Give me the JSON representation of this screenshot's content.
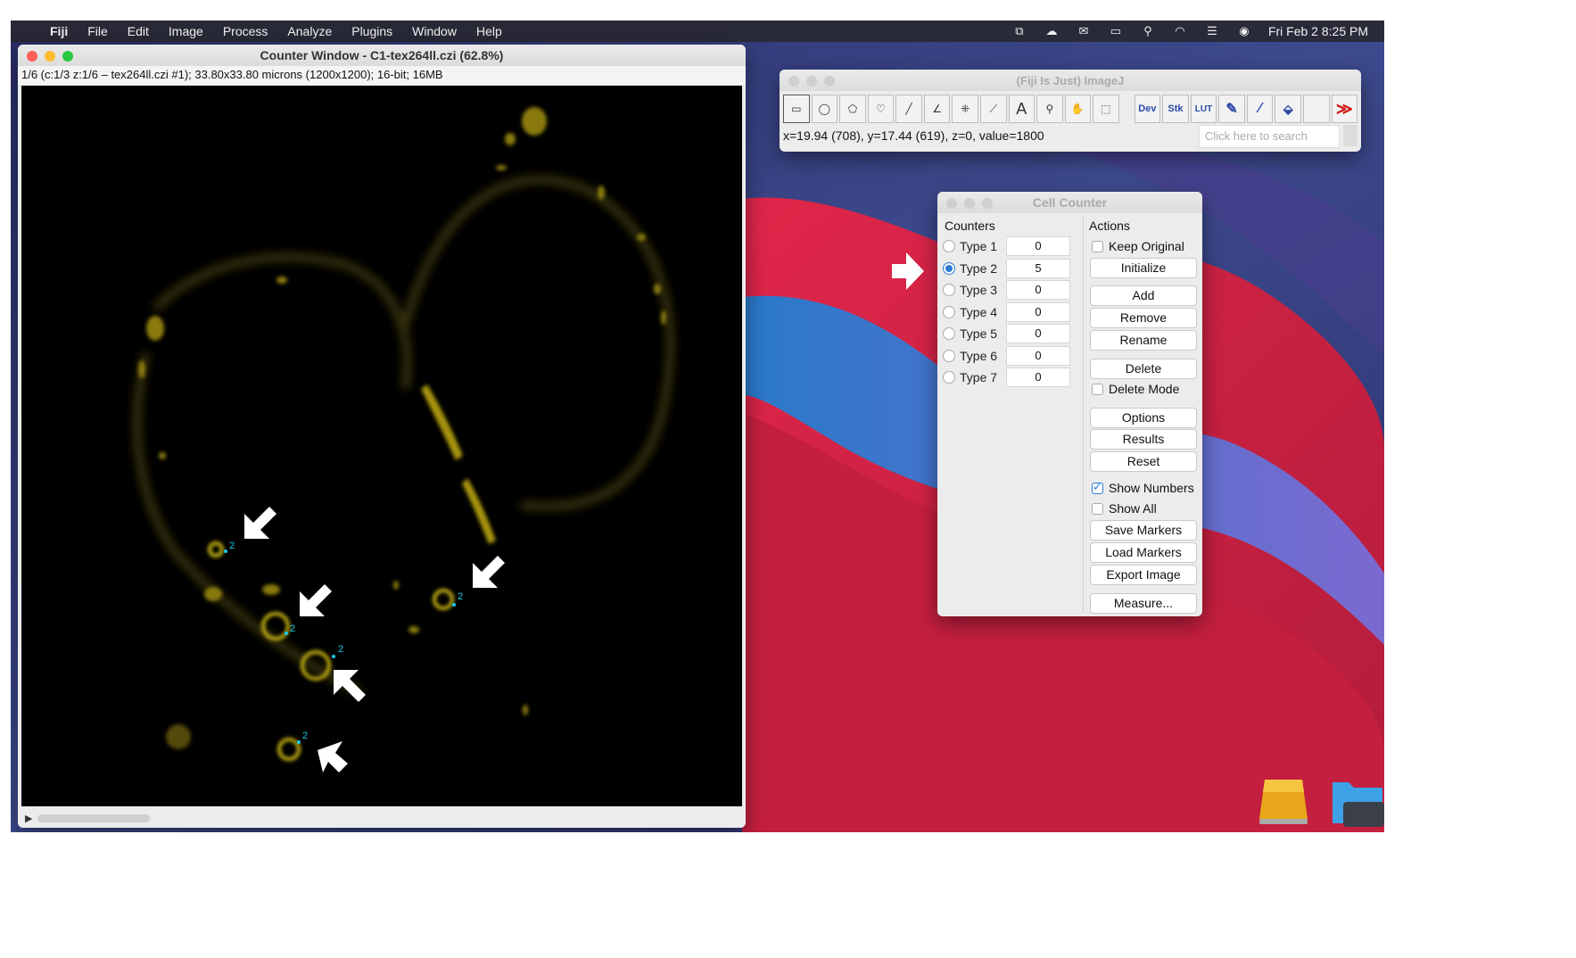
{
  "menubar": {
    "apple": "",
    "app": "Fiji",
    "items": [
      "File",
      "Edit",
      "Image",
      "Process",
      "Analyze",
      "Plugins",
      "Window",
      "Help"
    ],
    "clock": "Fri Feb 2  8:25 PM",
    "status_icons": [
      "dropbox-icon",
      "creative-cloud-icon",
      "outlook-icon",
      "battery-icon",
      "search-icon",
      "wifi-icon",
      "control-center-icon",
      "siri-icon"
    ]
  },
  "counter_window": {
    "title": "Counter Window - C1-tex264ll.czi (62.8%)",
    "info": "1/6 (c:1/3 z:1/6 – tex264ll.czi #1); 33.80x33.80 microns (1200x1200); 16-bit; 16MB",
    "marker_label": "2",
    "marker_color": "#1ac8e8"
  },
  "imagej": {
    "title": "(Fiji Is Just) ImageJ",
    "tools": [
      {
        "name": "rectangle-tool-icon",
        "glyph": "▭"
      },
      {
        "name": "oval-tool-icon",
        "glyph": "◯"
      },
      {
        "name": "polygon-tool-icon",
        "glyph": "⬠"
      },
      {
        "name": "freehand-tool-icon",
        "glyph": "♡"
      },
      {
        "name": "line-tool-icon",
        "glyph": "╱"
      },
      {
        "name": "angle-tool-icon",
        "glyph": "∠"
      },
      {
        "name": "point-tool-icon",
        "glyph": "⁜"
      },
      {
        "name": "wand-tool-icon",
        "glyph": "⟋"
      },
      {
        "name": "text-tool-icon",
        "glyph": "A"
      },
      {
        "name": "magnifier-tool-icon",
        "glyph": "⚲"
      },
      {
        "name": "hand-tool-icon",
        "glyph": "✋"
      },
      {
        "name": "dropper-tool-icon",
        "glyph": "⬚"
      }
    ],
    "tools2": [
      {
        "name": "dev-tool-icon",
        "glyph": "Dev"
      },
      {
        "name": "stk-tool-icon",
        "glyph": "Stk"
      },
      {
        "name": "lut-tool-icon",
        "glyph": "LUT"
      },
      {
        "name": "pencil-tool-icon",
        "glyph": "✎"
      },
      {
        "name": "brush-tool-icon",
        "glyph": "⁄"
      },
      {
        "name": "flood-fill-tool-icon",
        "glyph": "⬙"
      }
    ],
    "more_glyph": "≫",
    "status": "x=19.94 (708), y=17.44 (619), z=0, value=1800",
    "search_placeholder": "Click here to search"
  },
  "cell_counter": {
    "title": "Cell Counter",
    "counters_title": "Counters",
    "actions_title": "Actions",
    "selected_type": "Type 2",
    "counters": [
      {
        "label": "Type 1",
        "value": "0"
      },
      {
        "label": "Type 2",
        "value": "5"
      },
      {
        "label": "Type 3",
        "value": "0"
      },
      {
        "label": "Type 4",
        "value": "0"
      },
      {
        "label": "Type 5",
        "value": "0"
      },
      {
        "label": "Type 6",
        "value": "0"
      },
      {
        "label": "Type 7",
        "value": "0"
      }
    ],
    "keep_original": "Keep Original",
    "initialize": "Initialize",
    "add": "Add",
    "remove": "Remove",
    "rename": "Rename",
    "delete": "Delete",
    "delete_mode": "Delete Mode",
    "options": "Options",
    "results": "Results",
    "reset": "Reset",
    "show_numbers": "Show Numbers",
    "show_all": "Show All",
    "save_markers": "Save Markers",
    "load_markers": "Load Markers",
    "export_image": "Export Image",
    "measure": "Measure...",
    "show_numbers_checked": true,
    "show_all_checked": false,
    "keep_original_checked": false,
    "delete_mode_checked": false
  },
  "colors": {
    "accent": "#2a7bd4",
    "signal": "#d8c21a",
    "annotation_arrow": "#ffffff"
  }
}
